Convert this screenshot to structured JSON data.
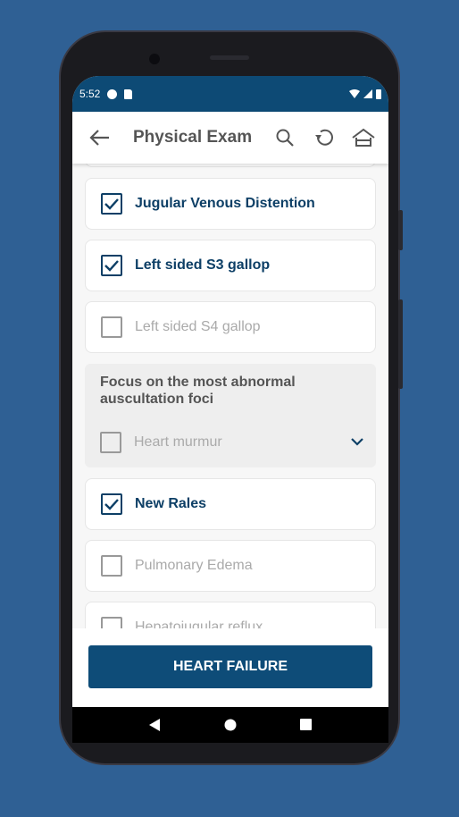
{
  "status": {
    "time": "5:52"
  },
  "header": {
    "title": "Physical Exam",
    "icons": [
      "back-arrow-icon",
      "search-icon",
      "reset-icon",
      "home-icon"
    ]
  },
  "items": [
    {
      "label": "Jugular Venous Distention",
      "checked": true
    },
    {
      "label": "Left sided S3 gallop",
      "checked": true
    },
    {
      "label": "Left sided S4 gallop",
      "checked": false
    }
  ],
  "group": {
    "heading": "Focus on the most abnormal auscultation foci",
    "item": {
      "label": "Heart murmur",
      "checked": false
    }
  },
  "items2": [
    {
      "label": "New Rales",
      "checked": true
    },
    {
      "label": "Pulmonary Edema",
      "checked": false
    },
    {
      "label": "Hepatojugular reflux",
      "checked": false
    }
  ],
  "footer": {
    "button": "HEART FAILURE"
  },
  "colors": {
    "primary": "#0d4a75",
    "background": "#2f6094"
  }
}
